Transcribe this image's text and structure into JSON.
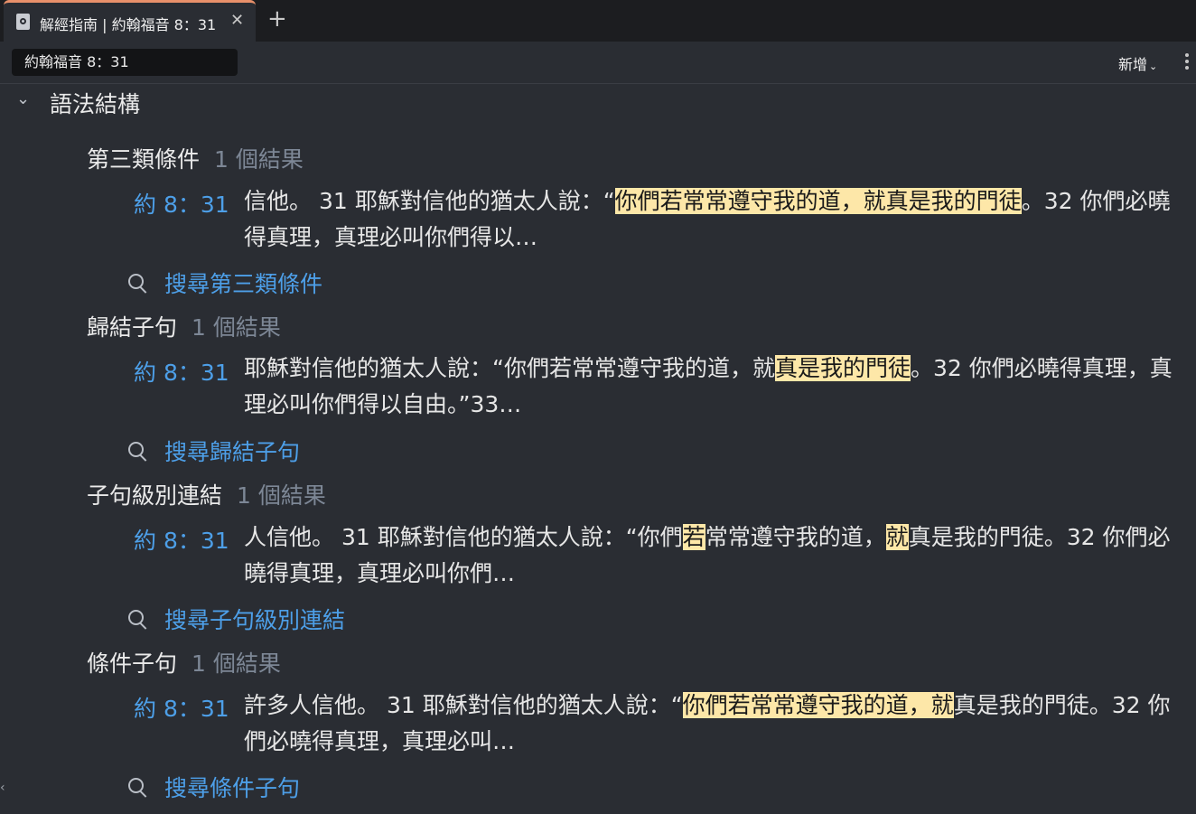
{
  "tab": {
    "title": "解經指南 | 約翰福音 8：31",
    "close_glyph": "✕",
    "new_tab_glyph": "+"
  },
  "toolbar": {
    "reference_value": "約翰福音 8：31",
    "add_label": "新增",
    "add_chevron": "⌄"
  },
  "section": {
    "title": "語法結構",
    "chevron": "⌄"
  },
  "groups": [
    {
      "title": "第三類條件",
      "count": "1 個結果",
      "ref": "約 8：31",
      "segments": [
        {
          "text": "信他。 31 耶穌對信他的猶太人說：“",
          "hl": false
        },
        {
          "text": "你們若常常遵守我的道，就真是我的門徒",
          "hl": true
        },
        {
          "text": "。32 你們必曉得真理，真理必叫你們得以…",
          "hl": false
        }
      ],
      "search": "搜尋第三類條件"
    },
    {
      "title": "歸結子句",
      "count": "1 個結果",
      "ref": "約 8：31",
      "segments": [
        {
          "text": "耶穌對信他的猶太人說：“你們若常常遵守我的道，就",
          "hl": false
        },
        {
          "text": "真是我的門徒",
          "hl": true
        },
        {
          "text": "。32 你們必曉得真理，真理必叫你們得以自由。”33…",
          "hl": false
        }
      ],
      "search": "搜尋歸結子句"
    },
    {
      "title": "子句級別連結",
      "count": "1 個結果",
      "ref": "約 8：31",
      "segments": [
        {
          "text": "人信他。 31 耶穌對信他的猶太人說：“你們",
          "hl": false
        },
        {
          "text": "若",
          "hl": true
        },
        {
          "text": "常常遵守我的道，",
          "hl": false
        },
        {
          "text": "就",
          "hl": true
        },
        {
          "text": "真是我的門徒。32 你們必曉得真理，真理必叫你們…",
          "hl": false
        }
      ],
      "search": "搜尋子句級別連結"
    },
    {
      "title": "條件子句",
      "count": "1 個結果",
      "ref": "約 8：31",
      "segments": [
        {
          "text": "許多人信他。 31 耶穌對信他的猶太人說：“",
          "hl": false
        },
        {
          "text": "你們若常常遵守我的道，就",
          "hl": true
        },
        {
          "text": "真是我的門徒。32 你們必曉得真理，真理必叫…",
          "hl": false
        }
      ],
      "search": "搜尋條件子句"
    }
  ],
  "icons": {
    "tab": "document-icon",
    "search": "search-icon",
    "more": "more-vertical-icon"
  },
  "colors": {
    "highlight": "#fde7a8",
    "link": "#4d9fe8",
    "tab_accent": "#e8906a",
    "count": "#7d8796"
  }
}
